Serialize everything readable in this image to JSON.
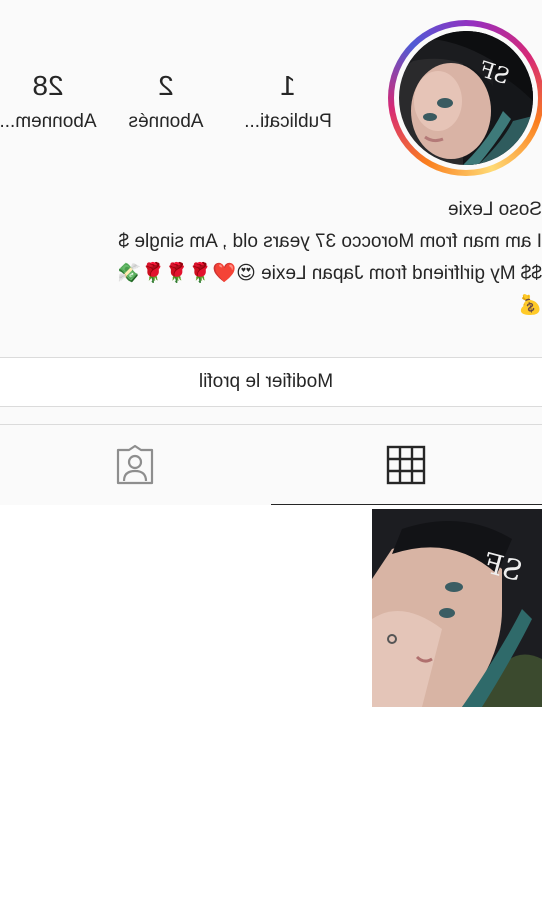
{
  "profile": {
    "name": "Soso Lexie",
    "avatar_alt": "profile-photo"
  },
  "stats": [
    {
      "value": "1",
      "label": "Publicati..."
    },
    {
      "value": "2",
      "label": "Abonnés"
    },
    {
      "value": "28",
      "label": "Abonnem..."
    }
  ],
  "bio": {
    "line1": "I am man from Morocco 37 years old , Am single $",
    "line2": "$$ My girlfriend  from Japan Lexie 😍❤️🌹🌹🌹💸",
    "line3": "💰"
  },
  "edit_profile_label": "Modifier le profil",
  "tabs": {
    "grid_icon": "grid-icon",
    "tagged_icon": "tagged-person-icon",
    "active": "grid"
  },
  "colors": {
    "text": "#262626",
    "divider": "#dbdbdb",
    "background": "#fafafa"
  }
}
